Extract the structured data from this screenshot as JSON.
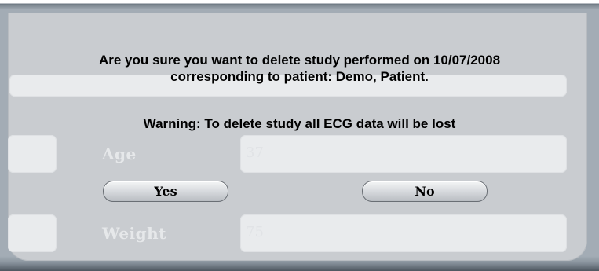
{
  "dialog": {
    "message_line1": "Are you sure you want to delete study performed on 10/07/2008",
    "message_line2": "corresponding to patient: Demo, Patient.",
    "warning": "Warning: To delete study all ECG data will be lost",
    "yes_label": "Yes",
    "no_label": "No"
  },
  "background_form": {
    "age_label": "Age",
    "age_value": "37",
    "weight_label": "Weight",
    "weight_value": "75"
  }
}
